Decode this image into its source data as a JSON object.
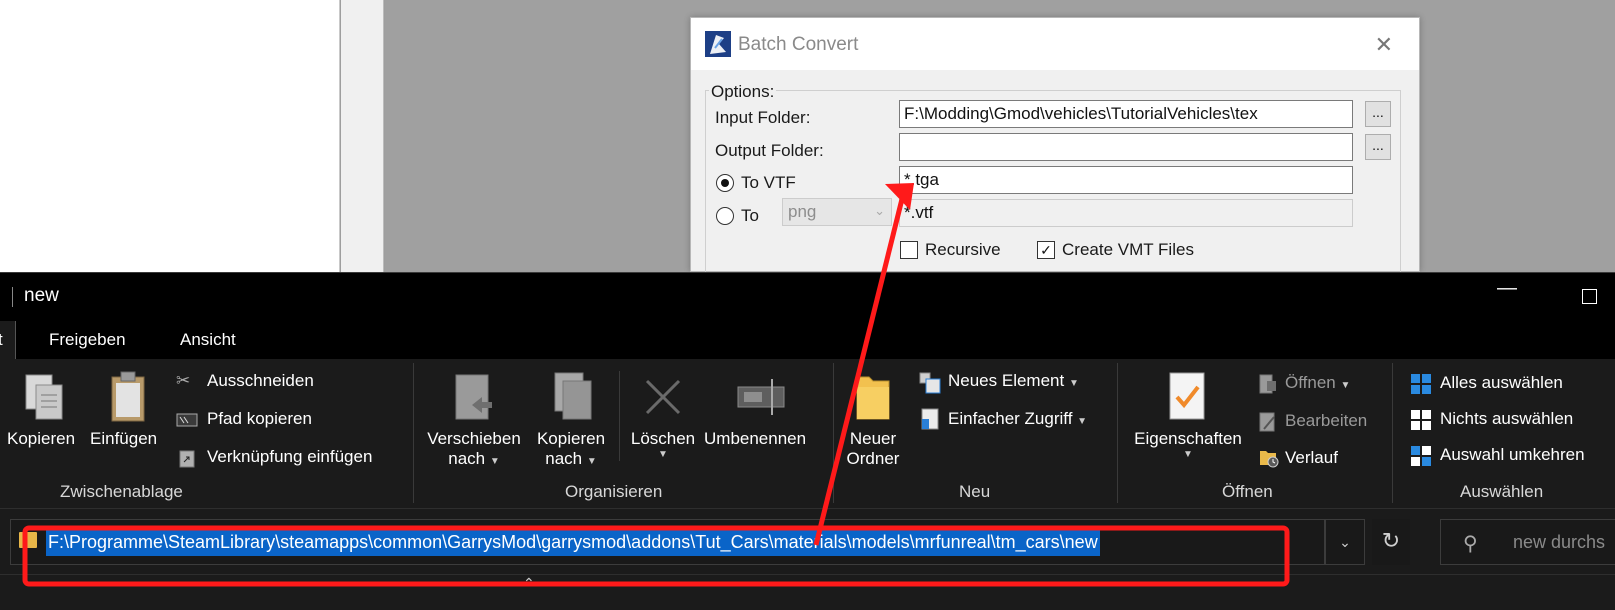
{
  "dialog": {
    "title": "Batch Convert",
    "close_glyph": "✕",
    "options_label": "Options:",
    "input_folder_label": "Input Folder:",
    "input_folder_value": "F:\\Modding\\Gmod\\vehicles\\TutorialVehicles\\tex",
    "output_folder_label": "Output Folder:",
    "output_folder_value": "",
    "browse_label": "...",
    "to_vtf_label": "To VTF",
    "to_vtf_selected": true,
    "to_label": "To",
    "to_format_value": "png",
    "tga_filter_value": "*.tga",
    "vtf_filter_value": "*.vtf",
    "recursive_label": "Recursive",
    "recursive_checked": false,
    "create_vmt_label": "Create VMT Files",
    "create_vmt_checked": true
  },
  "explorer": {
    "title": "new",
    "tabs": [
      "Freigeben",
      "Ansicht"
    ],
    "ribbon": {
      "clipboard": {
        "group_label": "Zwischenablage",
        "copy": "Kopieren",
        "paste": "Einfügen",
        "cut": "Ausschneiden",
        "copy_path": "Pfad kopieren",
        "paste_shortcut": "Verknüpfung einfügen"
      },
      "organize": {
        "group_label": "Organisieren",
        "move_to_line1": "Verschieben",
        "move_to_line2": "nach",
        "copy_to_line1": "Kopieren",
        "copy_to_line2": "nach",
        "delete": "Löschen",
        "rename": "Umbenennen"
      },
      "new": {
        "group_label": "Neu",
        "new_folder_line1": "Neuer",
        "new_folder_line2": "Ordner",
        "new_item": "Neues Element",
        "easy_access": "Einfacher Zugriff"
      },
      "open": {
        "group_label": "Öffnen",
        "properties": "Eigenschaften",
        "open": "Öffnen",
        "edit": "Bearbeiten",
        "history": "Verlauf"
      },
      "select": {
        "group_label": "Auswählen",
        "select_all": "Alles auswählen",
        "select_none": "Nichts auswählen",
        "invert_selection": "Auswahl umkehren"
      }
    },
    "address_bar": {
      "path": "F:\\Programme\\SteamLibrary\\steamapps\\common\\GarrysMod\\garrysmod\\addons\\Tut_Cars\\materials\\models\\mrfunreal\\tm_cars\\new"
    },
    "search_placeholder": "new durchs"
  },
  "colors": {
    "annotation_red": "#ff1a1a",
    "selection_blue": "#0a64c8",
    "explorer_bg": "#1b1b1b"
  }
}
